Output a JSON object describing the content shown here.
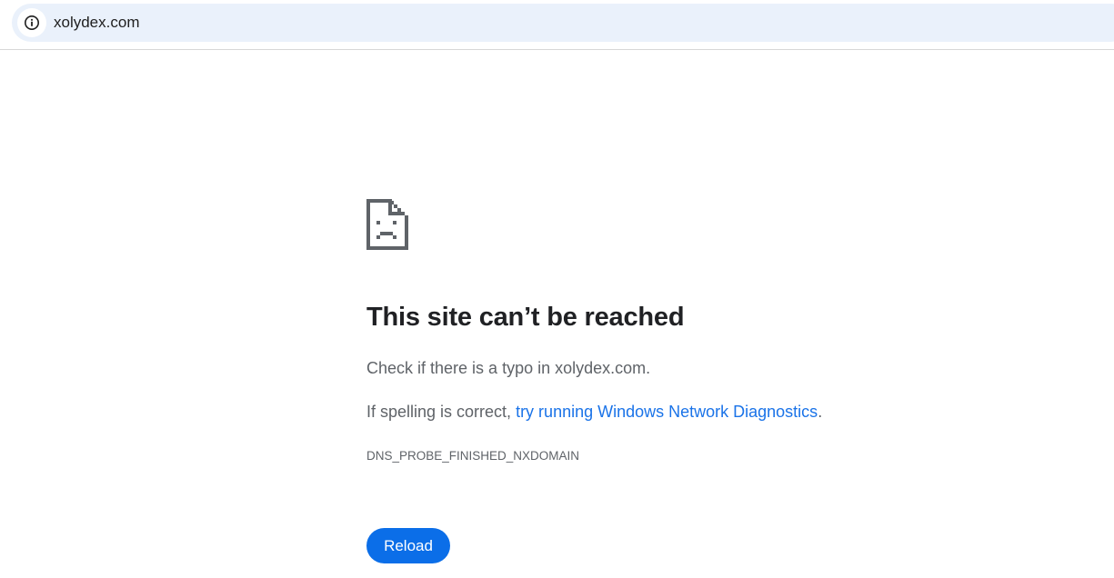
{
  "omnibox": {
    "url": "xolydex.com",
    "site_info_icon": "info-circle-icon"
  },
  "error": {
    "icon": "sad-page-icon",
    "title": "This site can’t be reached",
    "message_1": "Check if there is a typo in xolydex.com.",
    "message_2_prefix": "If spelling is correct, ",
    "message_2_link": "try running Windows Network Diagnostics",
    "message_2_suffix": ".",
    "code": "DNS_PROBE_FINISHED_NXDOMAIN",
    "reload_label": "Reload"
  },
  "colors": {
    "omnibox_bg": "#eaf1fb",
    "link": "#1a73e8",
    "button": "#0b6ee8",
    "title": "#202124",
    "body_text": "#5f6368"
  }
}
